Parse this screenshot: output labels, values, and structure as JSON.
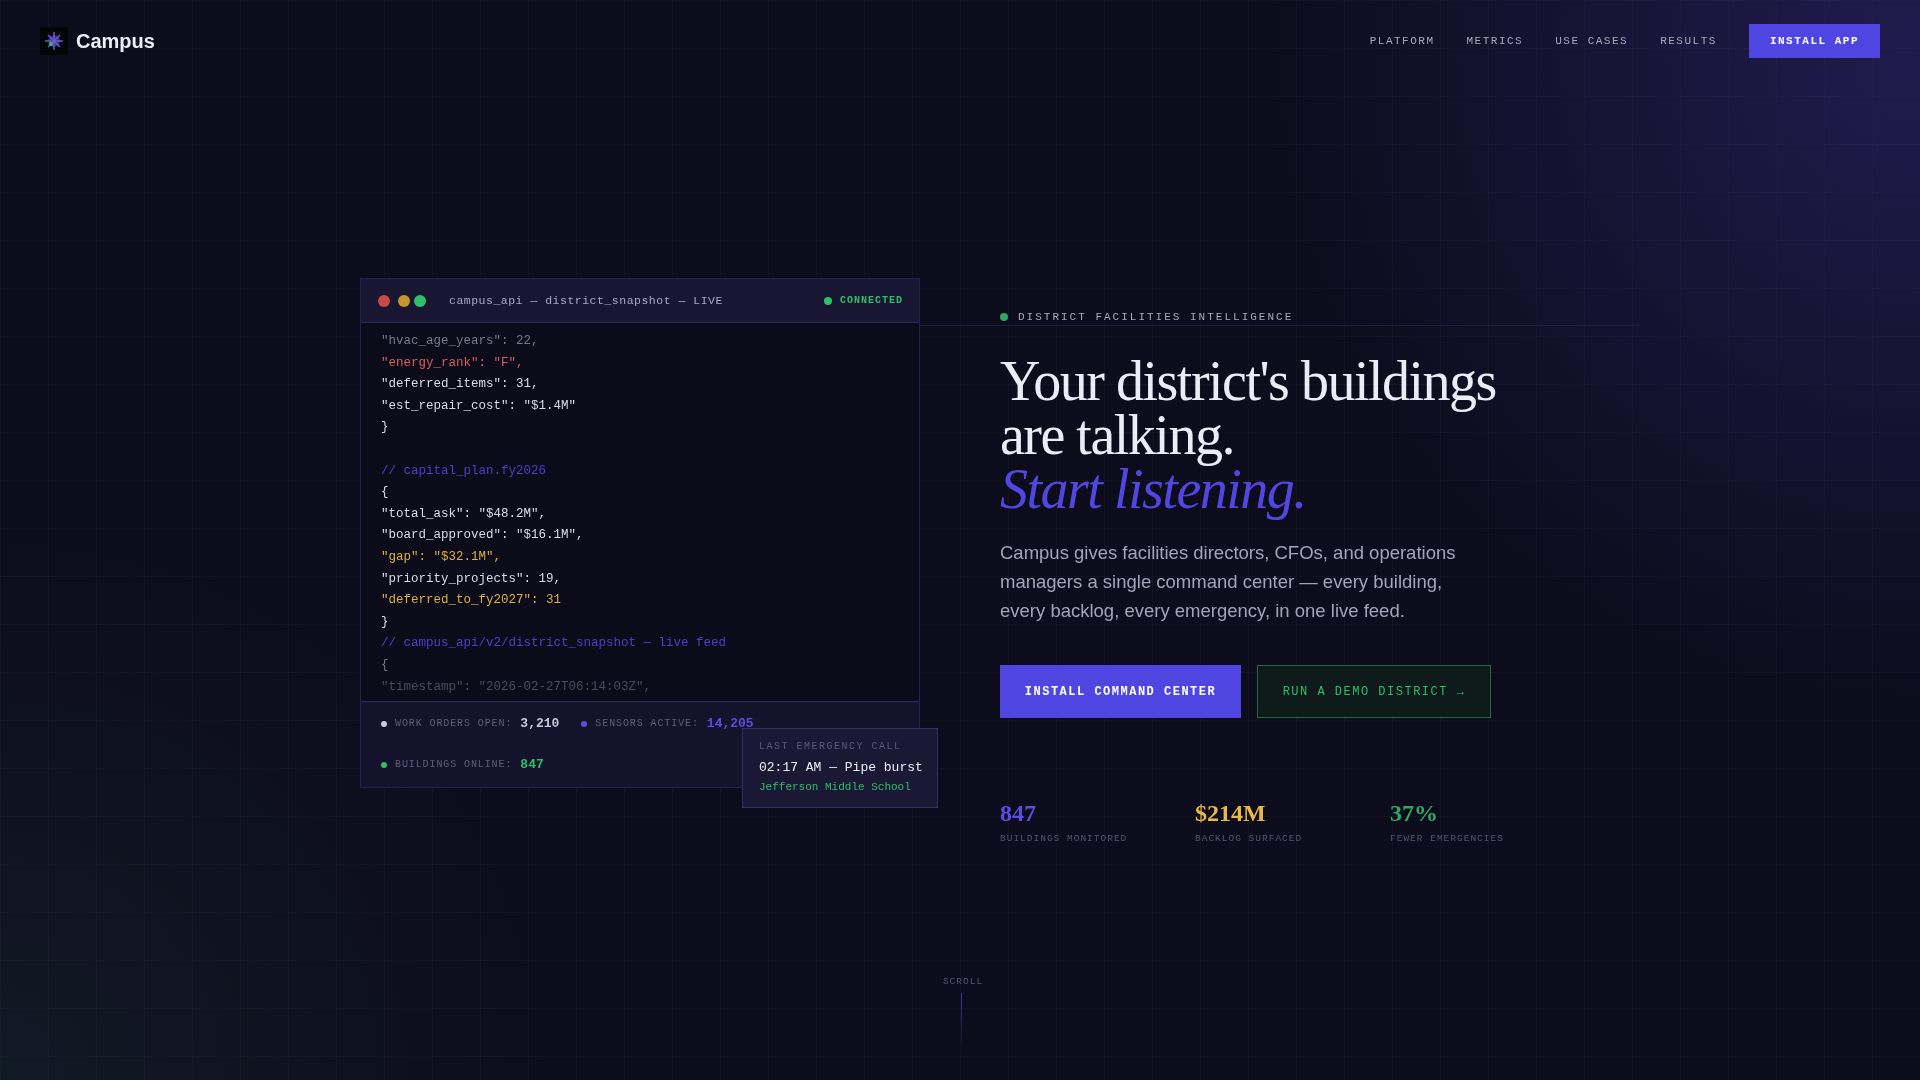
{
  "brand": {
    "name": "Campus"
  },
  "nav": {
    "links": [
      "PLATFORM",
      "METRICS",
      "USE CASES",
      "RESULTS"
    ],
    "cta": "INSTALL APP"
  },
  "console": {
    "title": "campus_api — district_snapshot — LIVE",
    "status": "CONNECTED",
    "lines": [
      {
        "kind": "dim",
        "text": "\"hvac_age_years\": 22,"
      },
      {
        "kind": "alert",
        "text": "\"energy_rank\": \"F\","
      },
      {
        "kind": "plain",
        "text": "\"deferred_items\": 31,"
      },
      {
        "kind": "plain",
        "text": "\"est_repair_cost\": \"$1.4M\""
      },
      {
        "kind": "plain",
        "text": "}"
      },
      {
        "kind": "blank"
      },
      {
        "kind": "comment",
        "text": "// capital_plan.fy2026"
      },
      {
        "kind": "plain",
        "text": "{"
      },
      {
        "kind": "plain",
        "text": "\"total_ask\": \"$48.2M\","
      },
      {
        "kind": "plain",
        "text": "\"board_approved\": \"$16.1M\","
      },
      {
        "kind": "warn",
        "text": "\"gap\": \"$32.1M\","
      },
      {
        "kind": "plain",
        "text": "\"priority_projects\": 19,"
      },
      {
        "kind": "warn",
        "text": "\"deferred_to_fy2027\": 31"
      },
      {
        "kind": "plain",
        "text": "}"
      },
      {
        "kind": "comment",
        "text": "// campus_api/v2/district_snapshot — live feed"
      },
      {
        "kind": "dim",
        "text": "{"
      },
      {
        "kind": "faded",
        "text": "\"timestamp\": \"2026-02-27T06:14:03Z\","
      }
    ],
    "stats": [
      {
        "label": "WORK ORDERS OPEN:",
        "value": "3,210",
        "color": "#c8c8d8"
      },
      {
        "label": "SENSORS ACTIVE:",
        "value": "14,205",
        "color": "#5b4de0"
      },
      {
        "label": "BUILDINGS ONLINE:",
        "value": "847",
        "color": "#2fbf6a"
      }
    ]
  },
  "emergency": {
    "label": "LAST EMERGENCY CALL",
    "event": "02:17 AM — Pipe burst",
    "school": "Jefferson Middle School"
  },
  "hero": {
    "eyebrow": "DISTRICT FACILITIES INTELLIGENCE",
    "headline": "Your district's buildings are talking.",
    "accent": "Start listening.",
    "body": "Campus gives facilities directors, CFOs, and operations managers a single command center — every building, every backlog, every emergency, in one live feed.",
    "primary": "INSTALL COMMAND CENTER",
    "secondary": "RUN A DEMO DISTRICT →",
    "metrics": [
      {
        "value": "847",
        "label": "BUILDINGS MONITORED",
        "color": "#5b4de0"
      },
      {
        "value": "$214M",
        "label": "BACKLOG SURFACED",
        "color": "#e8b84a"
      },
      {
        "value": "37%",
        "label": "FEWER EMERGENCIES",
        "color": "#2fa862"
      }
    ]
  },
  "scroll": "SCROLL"
}
